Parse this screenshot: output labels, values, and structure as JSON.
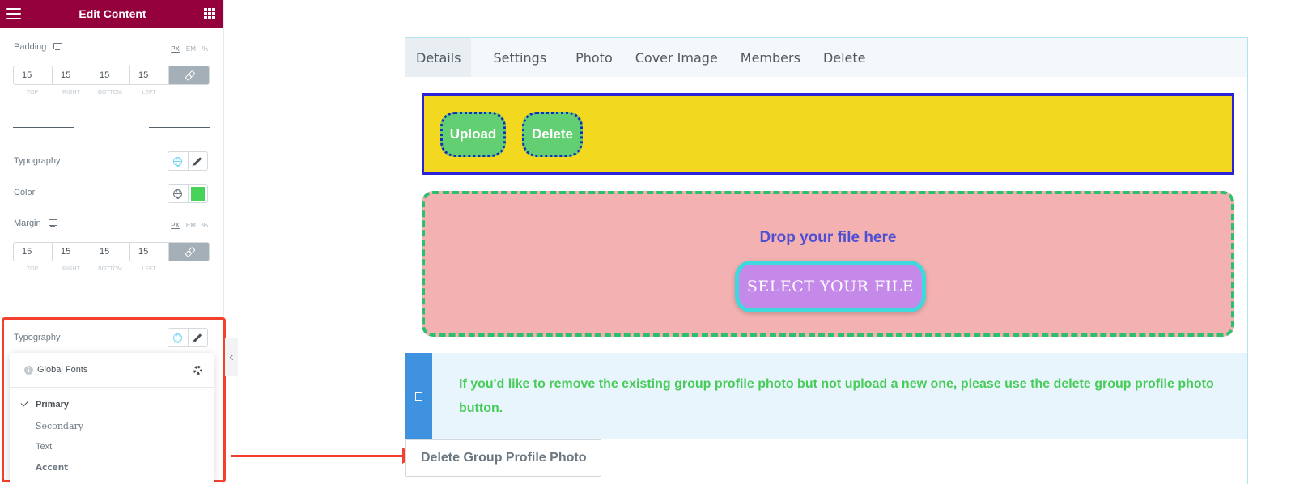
{
  "header": {
    "title": "Edit Content"
  },
  "padding": {
    "label": "Padding",
    "units": [
      "PX",
      "EM",
      "%"
    ],
    "values": [
      "15",
      "15",
      "15",
      "15"
    ],
    "sides": [
      "TOP",
      "RIGHT",
      "BOTTOM",
      "LEFT"
    ]
  },
  "typography1": {
    "label": "Typography"
  },
  "color": {
    "label": "Color",
    "value": "#47d35a"
  },
  "margin": {
    "label": "Margin",
    "units": [
      "PX",
      "EM",
      "%"
    ],
    "values": [
      "15",
      "15",
      "15",
      "15"
    ],
    "sides": [
      "TOP",
      "RIGHT",
      "BOTTOM",
      "LEFT"
    ]
  },
  "typography2": {
    "label": "Typography"
  },
  "global_fonts": {
    "title": "Global Fonts",
    "items": [
      "Primary",
      "Secondary",
      "Text",
      "Accent"
    ],
    "selected": "Primary"
  },
  "tabs": [
    "Details",
    "Settings",
    "Photo",
    "Cover Image",
    "Members",
    "Delete"
  ],
  "upload_area": {
    "upload_label": "Upload",
    "delete_label": "Delete"
  },
  "drop_area": {
    "prompt": "Drop your file here",
    "select_label": "SELECT YOUR FILE"
  },
  "notice": {
    "text": "If you'd like to remove the existing group profile photo but not upload a new one, please use the delete group profile photo button."
  },
  "delete_photo_button": "Delete Group Profile Photo",
  "colors": {
    "header_bg": "#93003c",
    "highlight": "#f4402f",
    "upload_bg": "#f2d920",
    "upload_border": "#2a24d6",
    "button_green": "#63cf73",
    "drop_bg": "#f4b1b1",
    "drop_border": "#2bc06b",
    "select_bg": "#c489e9",
    "select_border": "#3dd9dd",
    "notice_text": "#47cc5a",
    "notice_bar": "#3f92df"
  }
}
